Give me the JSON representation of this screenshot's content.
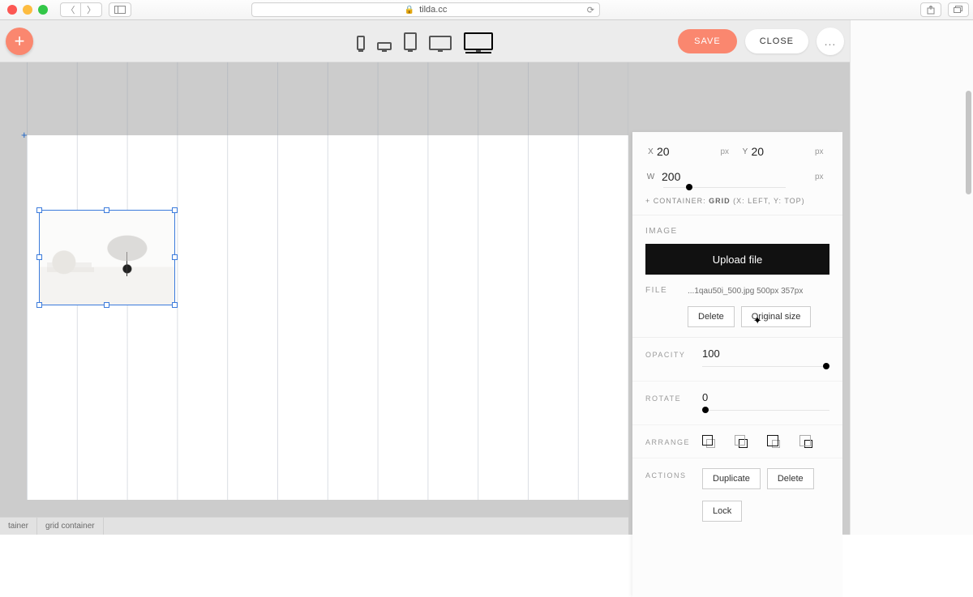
{
  "browser": {
    "url_host": "tilda.cc"
  },
  "toolbar": {
    "save": "SAVE",
    "close": "CLOSE",
    "more": "..."
  },
  "footer": {
    "crumb1": "tainer",
    "crumb2": "grid container"
  },
  "panel": {
    "pos": {
      "x": "20",
      "y": "20",
      "w": "200",
      "px": "px"
    },
    "container_note_prefix": "+ CONTAINER:",
    "container_note_grid": "GRID",
    "container_note_rest": "(X: LEFT, Y: TOP)",
    "image_title": "IMAGE",
    "upload": "Upload file",
    "file_label": "FILE",
    "file_value": "...1qau50i_500.jpg 500px 357px",
    "delete": "Delete",
    "original_size": "Original size",
    "opacity_label": "OPACITY",
    "opacity_value": "100",
    "rotate_label": "ROTATE",
    "rotate_value": "0",
    "arrange_label": "ARRANGE",
    "actions_label": "ACTIONS",
    "duplicate": "Duplicate",
    "delete2": "Delete",
    "lock": "Lock"
  }
}
